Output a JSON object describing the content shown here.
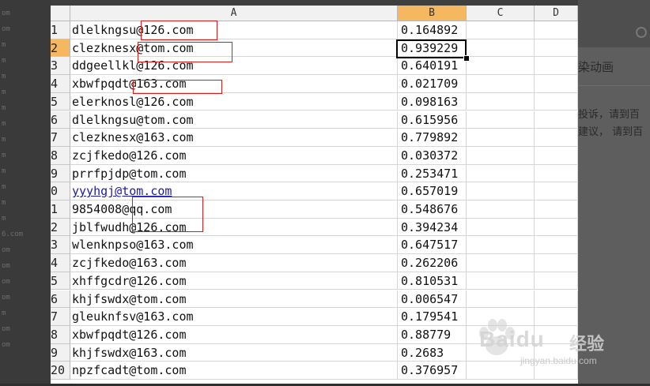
{
  "background": {
    "left_fragments": [
      "om",
      "om",
      "m",
      "m",
      "m",
      "m",
      "m",
      "m",
      "m",
      "m",
      "m",
      "m",
      "m",
      "m",
      "6.com",
      "om",
      "om",
      "om",
      "om",
      "m",
      "om",
      "om"
    ],
    "right_title": "染动画",
    "right_line1": "投诉，请到百",
    "right_line2": "建议， 请到百"
  },
  "sheet": {
    "columns": [
      "A",
      "B",
      "C",
      "D"
    ],
    "active_column": "B",
    "active_row_label": "2",
    "rows": [
      {
        "label": "1",
        "email": "dlelkngsu@126.com",
        "value": "0.164892"
      },
      {
        "label": "2",
        "email": "clezknesx@tom.com",
        "value": "0.939229"
      },
      {
        "label": "3",
        "email": "ddgeellkl@126.com",
        "value": "0.640191"
      },
      {
        "label": "4",
        "email": "xbwfpqdt@163.com",
        "value": "0.021709"
      },
      {
        "label": "5",
        "email": "elerknosl@126.com",
        "value": "0.098163"
      },
      {
        "label": "6",
        "email": "dlelkngsu@tom.com",
        "value": "0.615956"
      },
      {
        "label": "7",
        "email": "clezknesx@163.com",
        "value": "0.779892"
      },
      {
        "label": "8",
        "email": "zcjfkedo@126.com",
        "value": "0.030372"
      },
      {
        "label": "9",
        "email": "prrfpjdp@tom.com",
        "value": "0.253471"
      },
      {
        "label": "0",
        "email": "yyyhgj@tom.com",
        "value": "0.657019"
      },
      {
        "label": "1",
        "email": "9854008@qq.com",
        "value": "0.548676"
      },
      {
        "label": "2",
        "email": "jblfwudh@126.com",
        "value": "0.394234"
      },
      {
        "label": "3",
        "email": "wlenknpso@163.com",
        "value": "0.647517"
      },
      {
        "label": "4",
        "email": "zcjfkedo@163.com",
        "value": "0.262206"
      },
      {
        "label": "5",
        "email": "xhffgcdr@126.com",
        "value": "0.810531"
      },
      {
        "label": "6",
        "email": "khjfswdx@tom.com",
        "value": "0.006547"
      },
      {
        "label": "7",
        "email": "gleuknfsv@163.com",
        "value": "0.179541"
      },
      {
        "label": "8",
        "email": "xbwfpqdt@126.com",
        "value": "0.88779"
      },
      {
        "label": "9",
        "email": "khjfswdx@163.com",
        "value": "0.2683"
      },
      {
        "label": "20",
        "email": "npzfcadt@tom.com",
        "value": "0.376957"
      }
    ]
  },
  "watermark": {
    "brand": "Baidu",
    "brand_cn": "经验",
    "url": "jingyan.baidu.com"
  },
  "colors": {
    "active_header": "#f5b860",
    "annotation_red": "#d81b1b",
    "link": "#1a1aa8"
  }
}
